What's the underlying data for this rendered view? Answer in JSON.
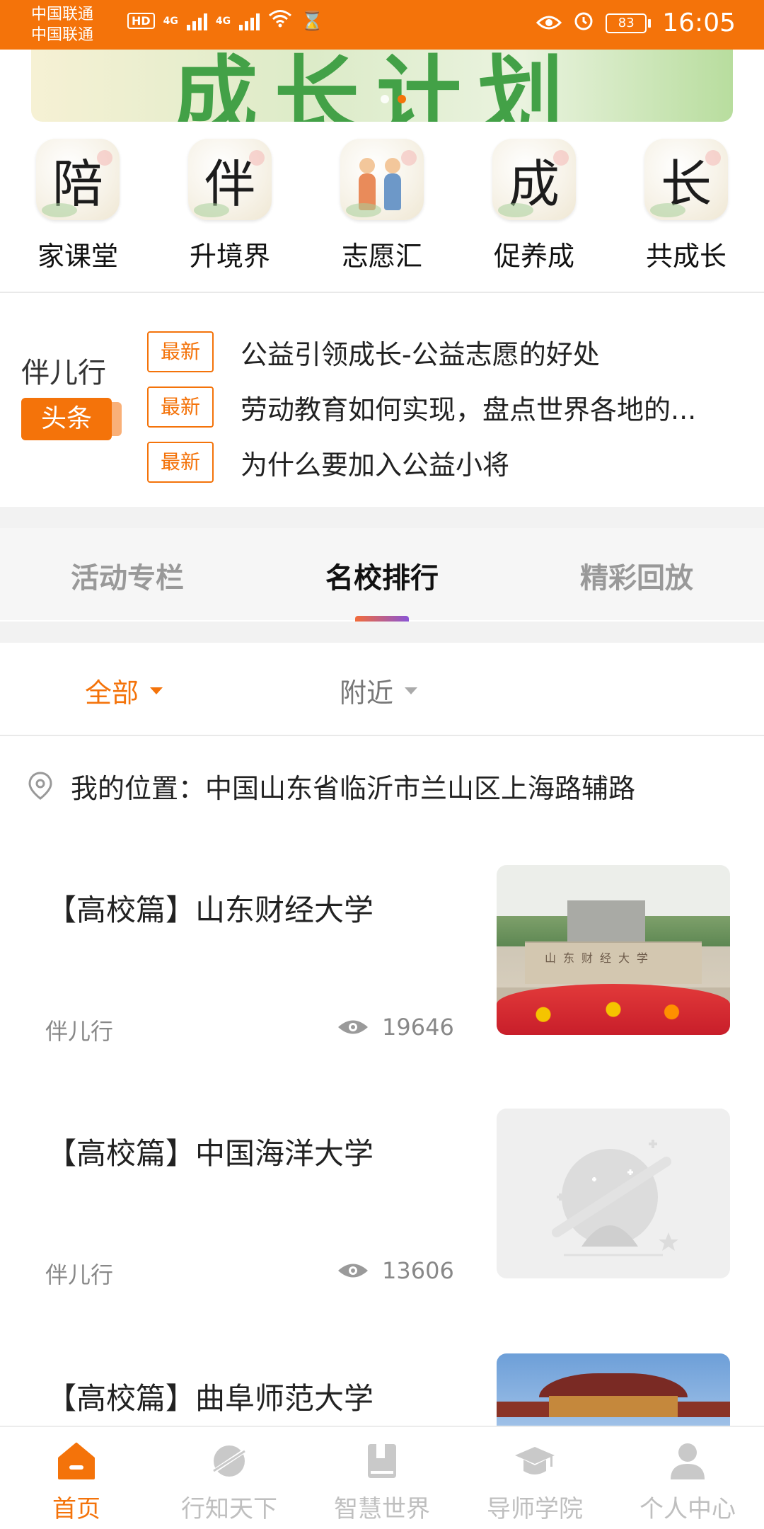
{
  "status_bar": {
    "carrier_1": "中国联通",
    "carrier_2": "中国联通",
    "hd": "HD",
    "net1": "4G",
    "net2": "4G",
    "battery": "83",
    "time": "16:05"
  },
  "banner": {
    "title": "成长计划",
    "slide_count": 2,
    "active_slide": 2
  },
  "categories": [
    {
      "label": "家课堂",
      "glyph": "陪"
    },
    {
      "label": "升境界",
      "glyph": "伴"
    },
    {
      "label": "志愿汇",
      "glyph": ""
    },
    {
      "label": "促养成",
      "glyph": "成"
    },
    {
      "label": "共成长",
      "glyph": "长"
    }
  ],
  "headlines": {
    "brand": "伴儿行",
    "tag": "头条",
    "items": [
      {
        "badge": "最新",
        "text": "公益引领成长-公益志愿的好处"
      },
      {
        "badge": "最新",
        "text": "劳动教育如何实现，盘点世界各地的..."
      },
      {
        "badge": "最新",
        "text": "为什么要加入公益小将"
      }
    ]
  },
  "tabs": [
    {
      "label": "活动专栏",
      "active": false
    },
    {
      "label": "名校排行",
      "active": true
    },
    {
      "label": "精彩回放",
      "active": false
    }
  ],
  "filters": {
    "all": "全部",
    "nearby": "附近"
  },
  "location": {
    "text": "我的位置：中国山东省临沂市兰山区上海路辅路"
  },
  "feed": [
    {
      "title": "【高校篇】山东财经大学",
      "source": "伴儿行",
      "views": "19646",
      "thumb": "campus",
      "thumb_text": "山东财经大学"
    },
    {
      "title": "【高校篇】中国海洋大学",
      "source": "伴儿行",
      "views": "13606",
      "thumb": "placeholder"
    },
    {
      "title": "【高校篇】曲阜师范大学",
      "thumb": "gate"
    }
  ],
  "bottom_nav": [
    {
      "label": "首页",
      "icon": "home-icon",
      "active": true
    },
    {
      "label": "行知天下",
      "icon": "planet-icon",
      "active": false
    },
    {
      "label": "智慧世界",
      "icon": "book-icon",
      "active": false
    },
    {
      "label": "导师学院",
      "icon": "graduation-cap-icon",
      "active": false
    },
    {
      "label": "个人中心",
      "icon": "person-icon",
      "active": false
    }
  ],
  "colors": {
    "accent": "#f4730a",
    "inactive": "#bfbfbf"
  }
}
